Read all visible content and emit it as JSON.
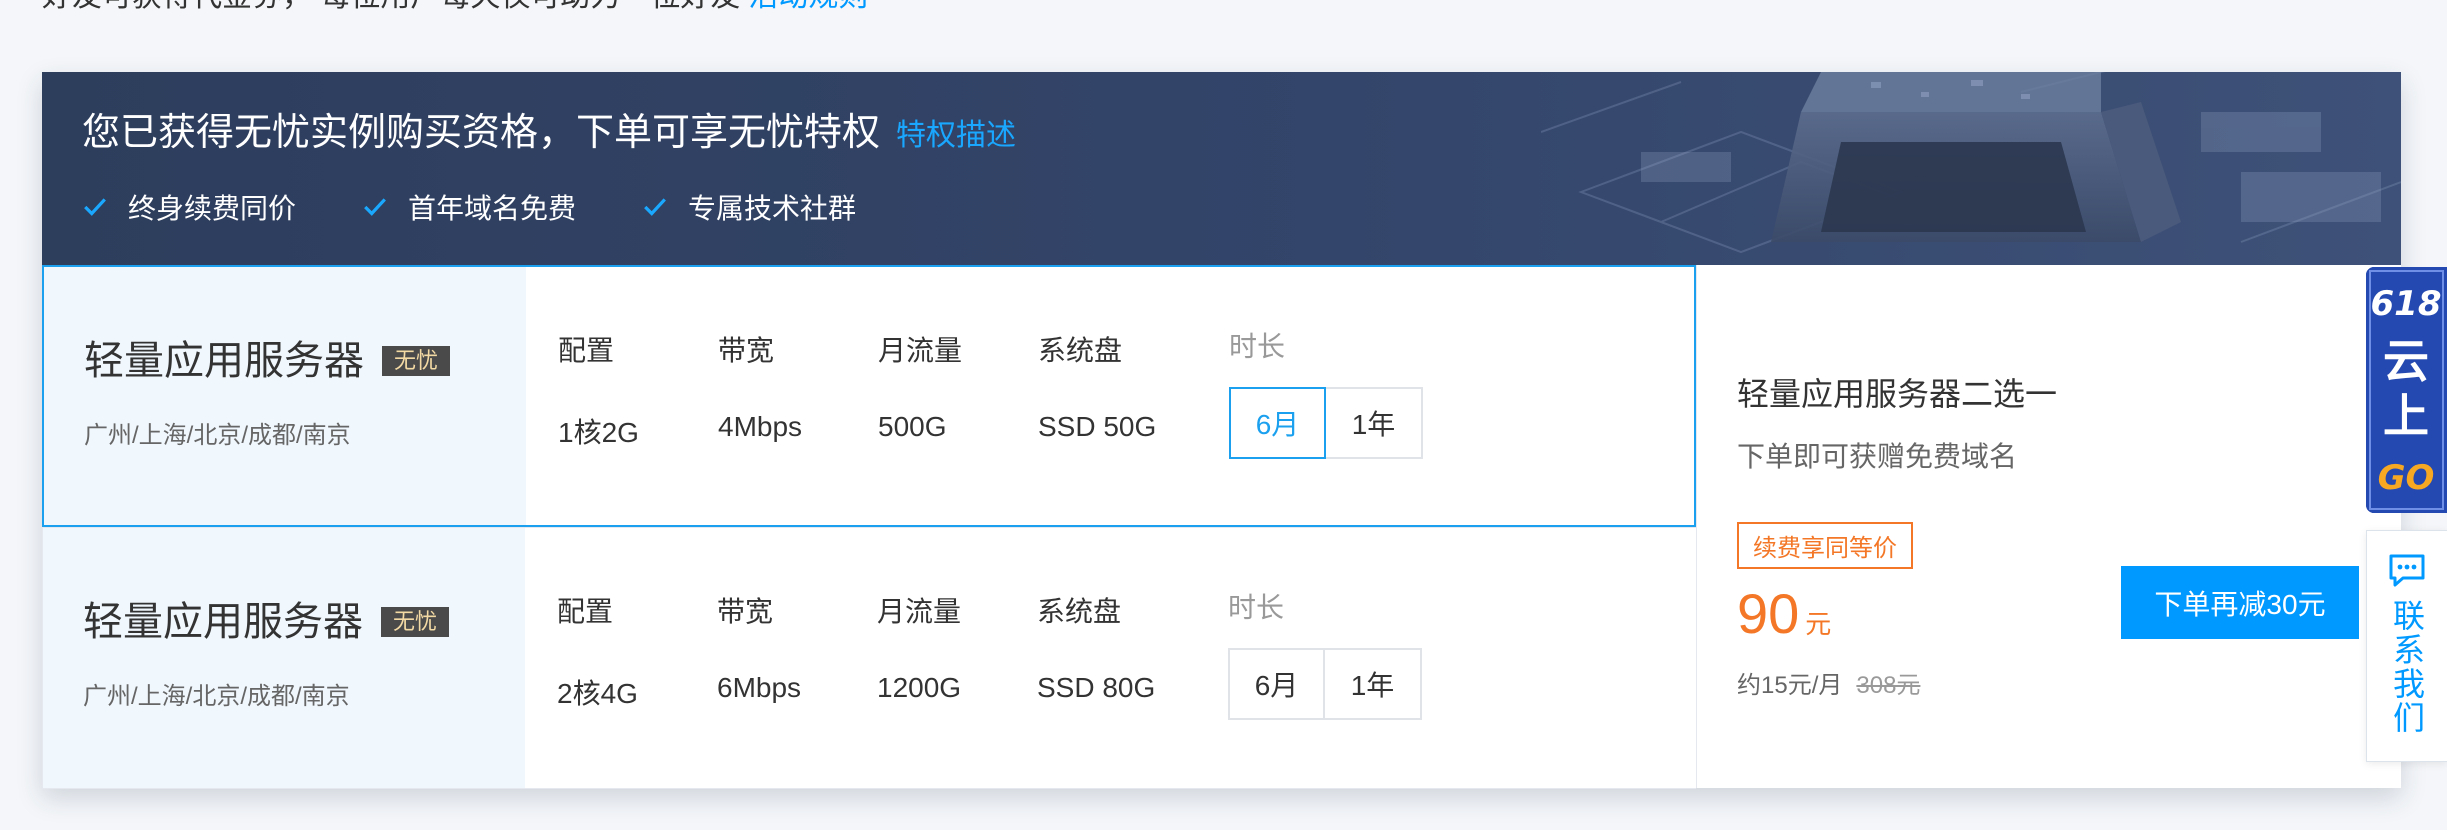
{
  "top_line": {
    "text": "好友可获得代金券， 每位用户每天仅可助力一位好友",
    "link": "活动规则"
  },
  "banner": {
    "title": "您已获得无忧实例购买资格，下单可享无忧特权",
    "link": "特权描述",
    "perks": [
      "终身续费同价",
      "首年域名免费",
      "专属技术社群"
    ]
  },
  "spec_labels": {
    "config": "配置",
    "bandwidth": "带宽",
    "traffic": "月流量",
    "disk": "系统盘",
    "duration": "时长"
  },
  "products": [
    {
      "name": "轻量应用服务器",
      "badge": "无忧",
      "regions": "广州/上海/北京/成都/南京",
      "config": "1核2G",
      "bandwidth": "4Mbps",
      "traffic": "500G",
      "disk": "SSD 50G",
      "durations": [
        "6月",
        "1年"
      ],
      "selected_duration": "6月"
    },
    {
      "name": "轻量应用服务器",
      "badge": "无忧",
      "regions": "广州/上海/北京/成都/南京",
      "config": "2核4G",
      "bandwidth": "6Mbps",
      "traffic": "1200G",
      "disk": "SSD 80G",
      "durations": [
        "6月",
        "1年"
      ],
      "selected_duration": ""
    }
  ],
  "summary": {
    "title": "轻量应用服务器二选一",
    "subtitle": "下单即可获赠免费域名",
    "tag": "续费享同等价",
    "price": "90",
    "price_unit": "元",
    "monthly": "约15元/月",
    "original_price": "308元",
    "order_button": "下单再减30元"
  },
  "sidebar": {
    "promo_line1": "618",
    "promo_line2": "云",
    "promo_line3": "上",
    "promo_line4": "GO",
    "contact": "联系我们"
  },
  "colors": {
    "accent": "#0099ff",
    "banner_bg": "#2d3d5c",
    "price": "#f37726",
    "badge_bg": "#4a4a4a"
  }
}
